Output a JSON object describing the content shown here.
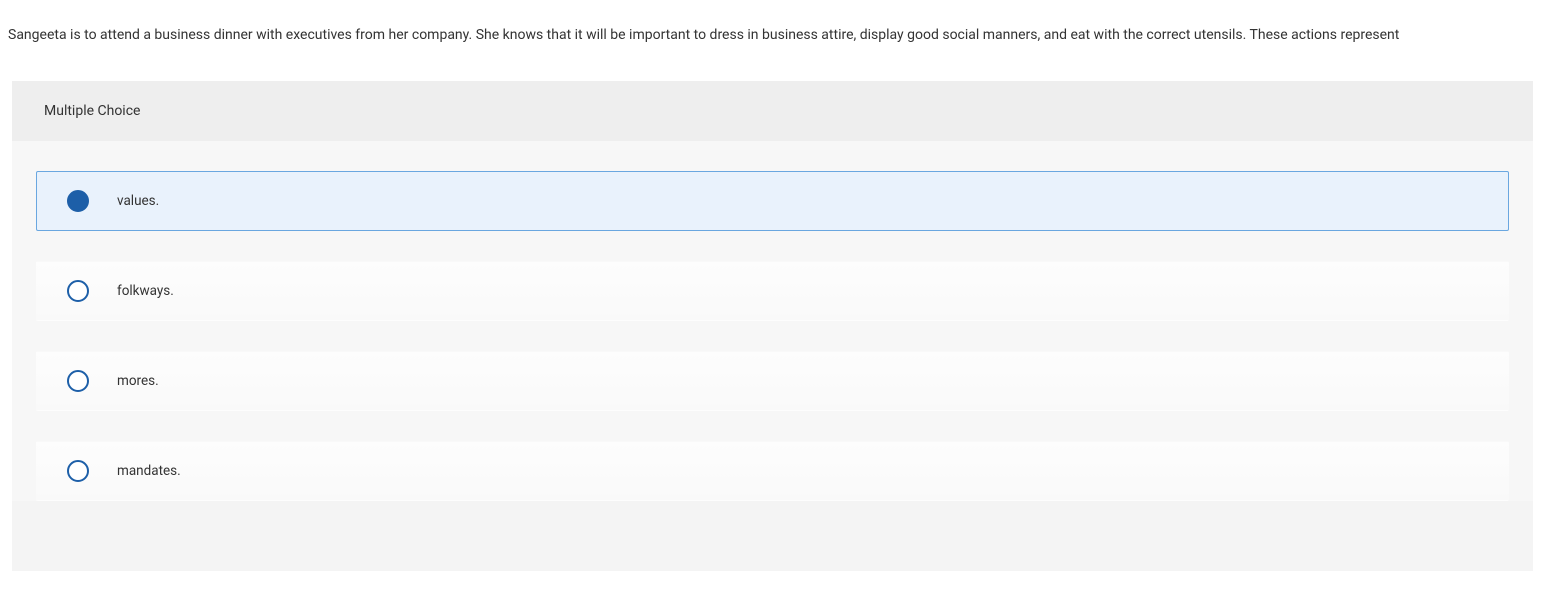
{
  "question": "Sangeeta is to attend a business dinner with executives from her company. She knows that it will be important to dress in business attire, display good social manners, and eat with the correct utensils. These actions represent",
  "question_type_label": "Multiple Choice",
  "options": [
    {
      "label": "values.",
      "selected": true
    },
    {
      "label": "folkways.",
      "selected": false
    },
    {
      "label": "mores.",
      "selected": false
    },
    {
      "label": "mandates.",
      "selected": false
    }
  ]
}
